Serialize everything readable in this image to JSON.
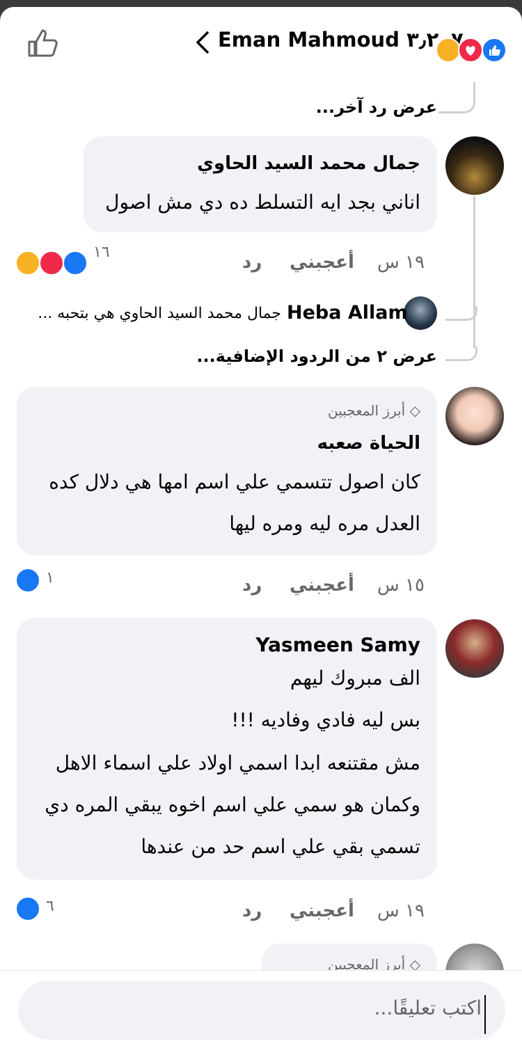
{
  "header": {
    "title": "Eman Mahmoud و٣٫٢٠٧",
    "reaction_icons": [
      "like-icon",
      "love-icon",
      "care-icon"
    ]
  },
  "thread": {
    "view_one_more": "عرض رد آخر..."
  },
  "comments": [
    {
      "name": "جمال محمد السيد الحاوي",
      "lines": [
        "اناني بجد ايه التسلط ده دي مش اصول"
      ],
      "time": "١٩ س",
      "like": "أعجبني",
      "reply": "رد",
      "reactions_count": "١٦"
    },
    {
      "name": "الحياة صعبه",
      "top_fan": "أبرز المعجبين",
      "lines": [
        "كان اصول تتسمي علي اسم امها هي دلال كده",
        "العدل مره ليه ومره ليها"
      ],
      "time": "١٥ س",
      "like": "أعجبني",
      "reply": "رد",
      "reactions_count": "١"
    },
    {
      "name": "Yasmeen Samy",
      "lines": [
        "الف مبروك ليهم",
        "بس ليه فادي وفاديه !!!",
        "مش مقتنعه ابدا اسمي اولاد علي اسماء الاهل",
        "وكمان هو سمي علي اسم اخوه يبقي المره دي",
        "تسمي بقي علي اسم حد من عندها"
      ],
      "time": "١٩ س",
      "like": "أعجبني",
      "reply": "رد",
      "reactions_count": "٦"
    },
    {
      "top_fan": "أبرز المعجبين"
    }
  ],
  "reply_preview": {
    "name": "Heba Allam",
    "snippet": "جمال محمد السيد الحاوي هي بتحبه ..."
  },
  "more_replies": "عرض ٢ من الردود الإضافية...",
  "composer": {
    "placeholder": "اكتب تعليقًا..."
  },
  "colors": {
    "like": "#1877f2",
    "love": "#f02849",
    "care": "#f7b125",
    "bubble": "#f0f2f5",
    "meta": "#65676b"
  }
}
